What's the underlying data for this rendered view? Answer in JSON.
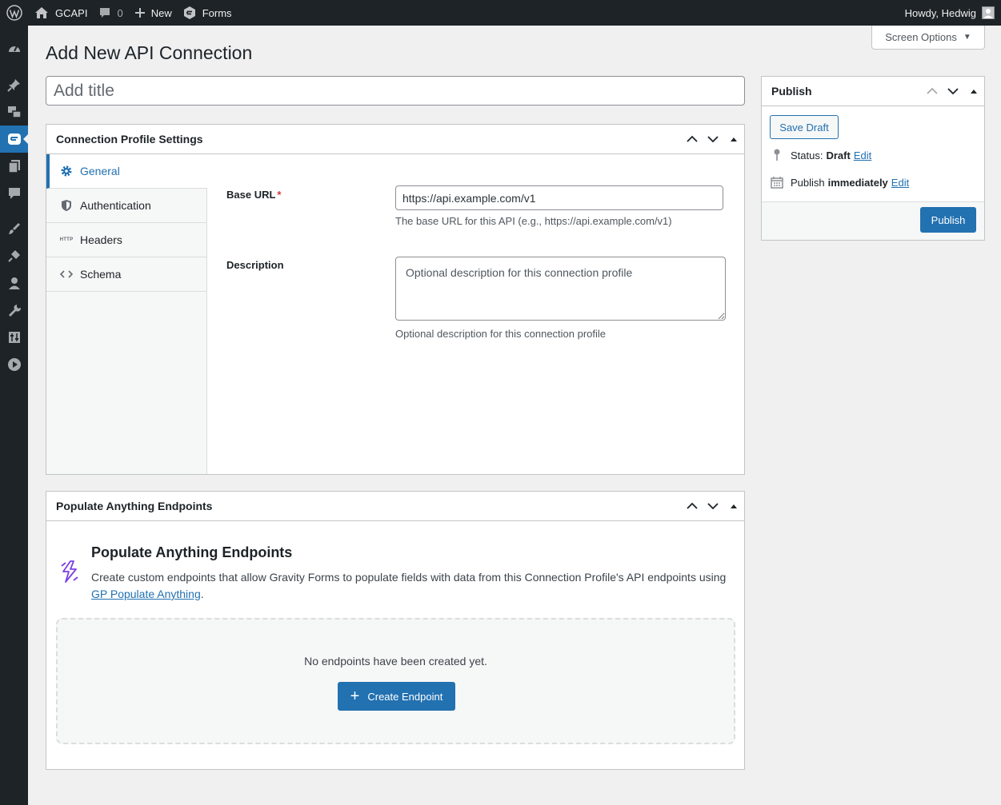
{
  "adminbar": {
    "site_name": "GCAPI",
    "comments_count": "0",
    "new_label": "New",
    "forms_label": "Forms",
    "howdy": "Howdy, Hedwig"
  },
  "screen_options": {
    "label": "Screen Options"
  },
  "page": {
    "title": "Add New API Connection",
    "title_placeholder": "Add title"
  },
  "connection_profile": {
    "heading": "Connection Profile Settings",
    "tabs": [
      {
        "label": "General",
        "icon": "gear-icon",
        "active": true
      },
      {
        "label": "Authentication",
        "icon": "shield-icon",
        "active": false
      },
      {
        "label": "Headers",
        "icon": "http-icon",
        "active": false
      },
      {
        "label": "Schema",
        "icon": "code-icon",
        "active": false
      }
    ],
    "base_url": {
      "label": "Base URL",
      "required_mark": "*",
      "value": "https://api.example.com/v1",
      "help": "The base URL for this API (e.g., https://api.example.com/v1)"
    },
    "description": {
      "label": "Description",
      "placeholder": "Optional description for this connection profile",
      "help": "Optional description for this connection profile"
    }
  },
  "endpoints": {
    "heading": "Populate Anything Endpoints",
    "title": "Populate Anything Endpoints",
    "desc_before": "Create custom endpoints that allow Gravity Forms to populate fields with data from this Connection Profile's API endpoints using ",
    "desc_link": "GP Populate Anything",
    "desc_after": ".",
    "empty_message": "No endpoints have been created yet.",
    "create_button": "Create Endpoint"
  },
  "publish": {
    "heading": "Publish",
    "save_draft": "Save Draft",
    "status_label": "Status:",
    "status_value": "Draft",
    "status_edit": "Edit",
    "publish_label": "Publish",
    "publish_value": "immediately",
    "publish_edit": "Edit",
    "publish_button": "Publish"
  },
  "colors": {
    "accent": "#2271b1",
    "admin_bar": "#1d2327",
    "required": "#d63638",
    "bolt": "#7b3fe4"
  }
}
